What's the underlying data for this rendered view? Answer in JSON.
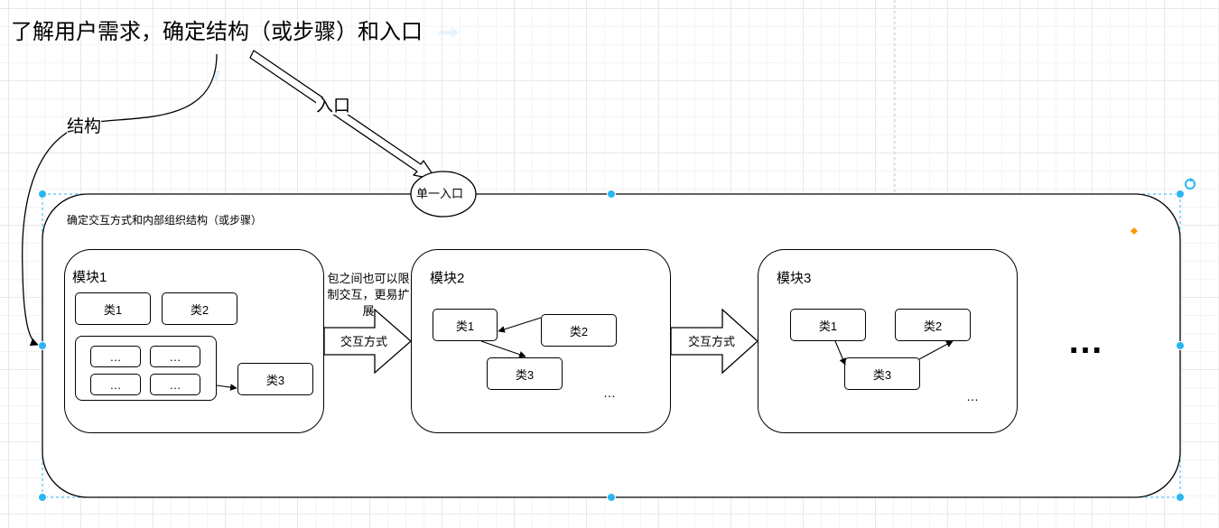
{
  "title": "了解用户需求，确定结构（或步骤）和入口",
  "edge_structure_label": "结构",
  "edge_entry_label": "入口",
  "entry_node_label": "单一入口",
  "container_label": "确定交互方式和内部组织结构（或步骤）",
  "modules": [
    {
      "label": "模块1",
      "classes": [
        "类1",
        "类2",
        "类3"
      ],
      "inner_items": [
        "…",
        "…",
        "…",
        "…"
      ]
    },
    {
      "label": "模块2",
      "classes": [
        "类1",
        "类2",
        "类3"
      ],
      "more": "…"
    },
    {
      "label": "模块3",
      "classes": [
        "类1",
        "类2",
        "类3"
      ],
      "more": "…"
    }
  ],
  "between_note": "包之间也可以限制交互，更易扩展",
  "arrow1_label": "交互方式",
  "arrow2_label": "交互方式",
  "ellipsis": "…",
  "colors": {
    "selection": "#29b6f2",
    "accent": "#ff9900",
    "grid": "#e8e8e8"
  }
}
